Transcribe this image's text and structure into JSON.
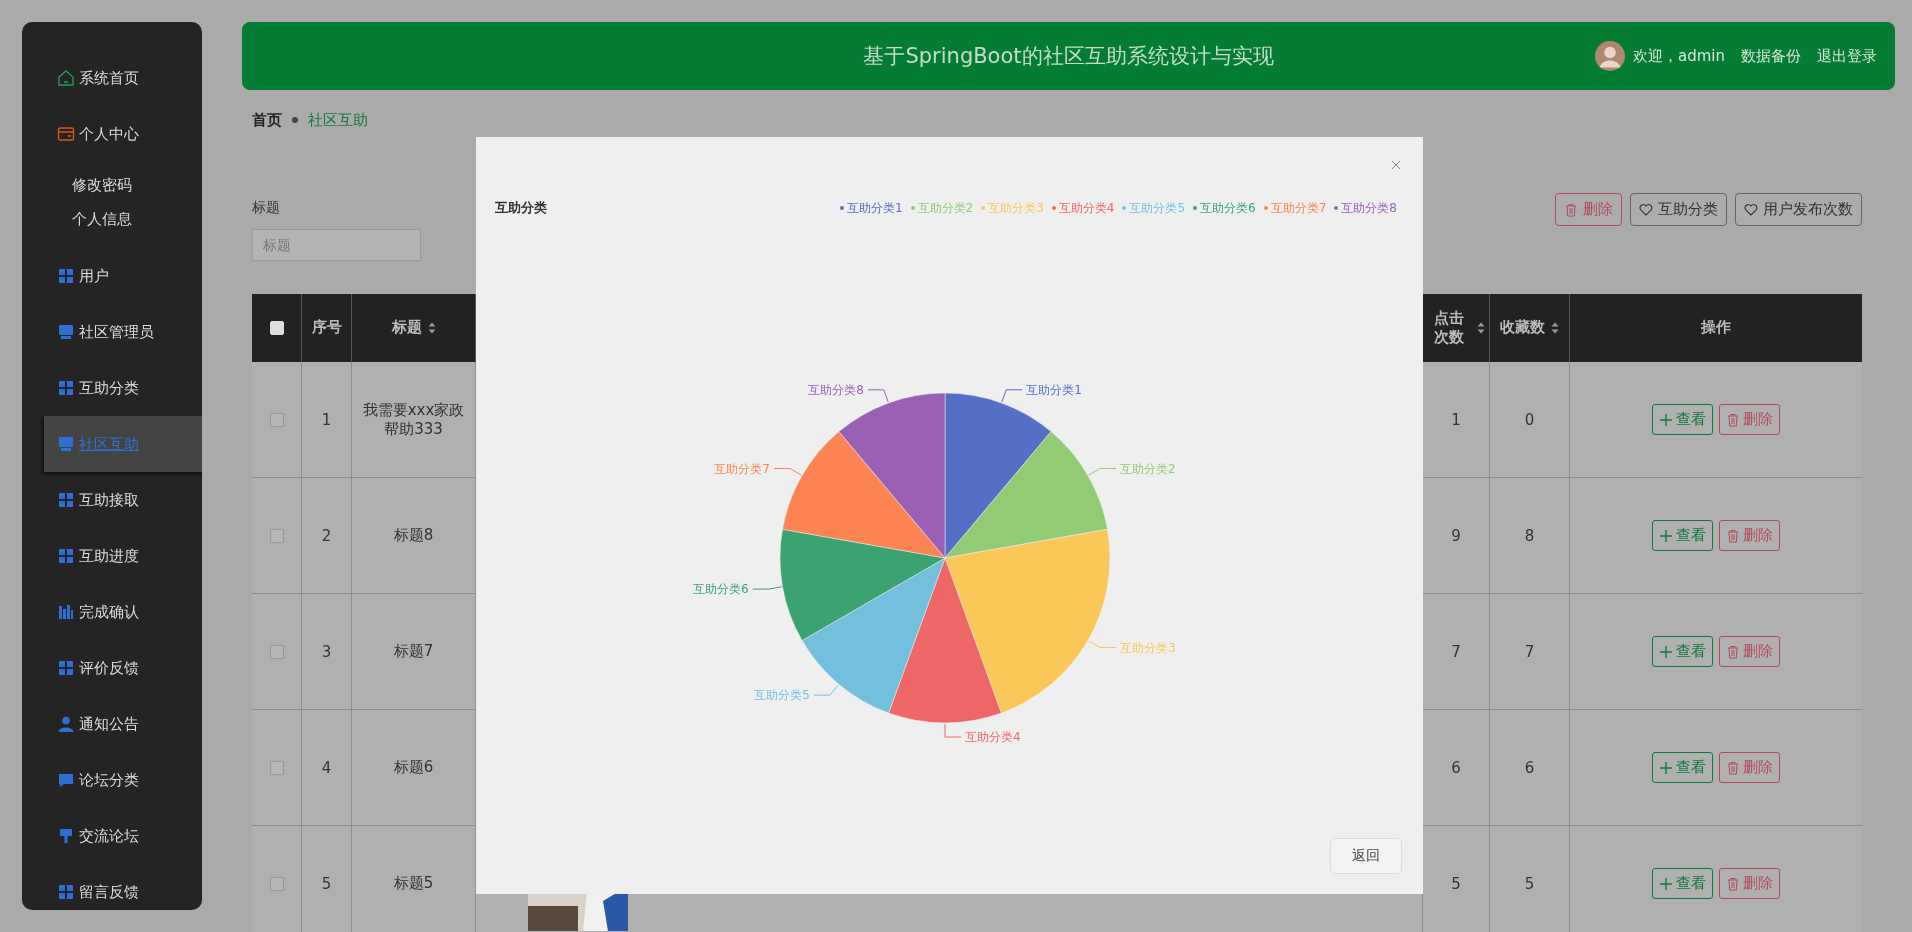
{
  "sidebar": {
    "items": [
      {
        "label": "系统首页",
        "selected": false
      },
      {
        "label": "个人中心",
        "selected": false,
        "children": [
          {
            "label": "修改密码",
            "selected": false
          },
          {
            "label": "个人信息",
            "selected": false
          }
        ]
      },
      {
        "label": "用户",
        "selected": false
      },
      {
        "label": "社区管理员",
        "selected": false
      },
      {
        "label": "互助分类",
        "selected": false
      },
      {
        "label": "社区互助",
        "selected": true
      },
      {
        "label": "互助接取",
        "selected": false
      },
      {
        "label": "互助进度",
        "selected": false
      },
      {
        "label": "完成确认",
        "selected": false
      },
      {
        "label": "评价反馈",
        "selected": false
      },
      {
        "label": "通知公告",
        "selected": false
      },
      {
        "label": "论坛分类",
        "selected": false
      },
      {
        "label": "交流论坛",
        "selected": false
      },
      {
        "label": "留言反馈",
        "selected": false
      }
    ]
  },
  "header": {
    "title": "基于SpringBoot的社区互助系统设计与实现",
    "welcome": "欢迎，admin",
    "links": [
      "数据备份",
      "退出登录"
    ]
  },
  "breadcrumb": [
    "首页",
    "社区互助"
  ],
  "search": {
    "label": "标题",
    "placeholder": "标题"
  },
  "toolbar": [
    {
      "kind": "danger",
      "label": "删除"
    },
    {
      "kind": "plain",
      "label": "互助分类"
    },
    {
      "kind": "plain",
      "label": "用户发布次数"
    }
  ],
  "table": {
    "select_all_checked": false,
    "columns": [
      {
        "label": "序号",
        "sortable": false
      },
      {
        "label": "标题",
        "sortable": true
      },
      {
        "label": "点击次数",
        "sortable": true
      },
      {
        "label": "收藏数",
        "sortable": true
      },
      {
        "label": "操作",
        "sortable": false
      }
    ],
    "rows": [
      {
        "checked": false,
        "no": "1",
        "title": "我需要xxx家政帮助333",
        "clicks": "1",
        "favorites": "0",
        "actions": [
          "查看",
          "删除"
        ]
      },
      {
        "checked": false,
        "no": "2",
        "title": "标题8",
        "clicks": "9",
        "favorites": "8",
        "actions": [
          "查看",
          "删除"
        ]
      },
      {
        "checked": false,
        "no": "3",
        "title": "标题7",
        "clicks": "7",
        "favorites": "7",
        "actions": [
          "查看",
          "删除"
        ]
      },
      {
        "checked": false,
        "no": "4",
        "title": "标题6",
        "clicks": "6",
        "favorites": "6",
        "actions": [
          "查看",
          "删除"
        ]
      },
      {
        "checked": false,
        "no": "5",
        "title": "标题5",
        "clicks": "5",
        "favorites": "5",
        "actions": [
          "查看",
          "删除"
        ],
        "cover": {
          "kind": "picture"
        }
      }
    ]
  },
  "dialog": {
    "legend": [
      {
        "label": "互助分类1",
        "color": "#5470c6"
      },
      {
        "label": "互助分类2",
        "color": "#91cc75"
      },
      {
        "label": "互助分类3",
        "color": "#fac858"
      },
      {
        "label": "互助分类4",
        "color": "#ee6666"
      },
      {
        "label": "互助分类5",
        "color": "#73c0de"
      },
      {
        "label": "互助分类6",
        "color": "#3ba272"
      },
      {
        "label": "互助分类7",
        "color": "#fc8452"
      },
      {
        "label": "互助分类8",
        "color": "#9a60b4"
      }
    ],
    "chart_data": {
      "type": "pie",
      "title": "互助分类",
      "categories": [
        "互助分类1",
        "互助分类2",
        "互助分类3",
        "互助分类4",
        "互助分类5",
        "互助分类6",
        "互助分类7",
        "互助分类8"
      ],
      "series": [
        {
          "values": [
            1,
            1,
            2,
            1,
            1,
            1,
            1,
            1
          ]
        }
      ]
    },
    "button": "返回"
  }
}
